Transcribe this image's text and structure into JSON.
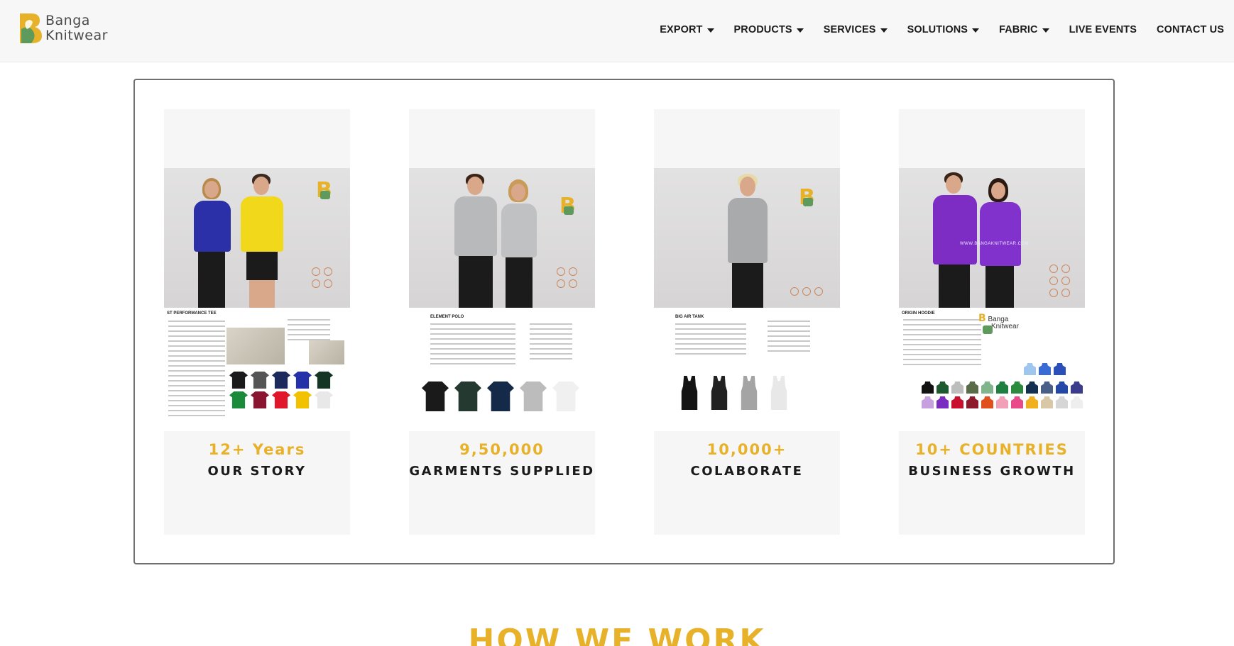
{
  "brand": {
    "line1": "Banga",
    "line2": "Knitwear"
  },
  "nav": [
    {
      "label": "EXPORT",
      "dropdown": true
    },
    {
      "label": "PRODUCTS",
      "dropdown": true
    },
    {
      "label": "SERVICES",
      "dropdown": true
    },
    {
      "label": "SOLUTIONS",
      "dropdown": true
    },
    {
      "label": "FABRIC",
      "dropdown": true
    },
    {
      "label": "LIVE EVENTS",
      "dropdown": false
    },
    {
      "label": "CONTACT US",
      "dropdown": false
    }
  ],
  "cards": [
    {
      "sheet_title": "ST PERFORMANCE TEE",
      "stat": "12+ Years",
      "caption": "OUR STORY"
    },
    {
      "sheet_title": "ELEMENT POLO",
      "stat": "9,50,000",
      "caption": "GARMENTS SUPPLIED"
    },
    {
      "sheet_title": "BIG AIR TANK",
      "stat": "10,000+",
      "caption": "COLABORATE"
    },
    {
      "sheet_title": "ORIGIN HOODIE",
      "stat": "10+ COUNTRIES",
      "caption": "BUSINESS GROWTH"
    }
  ],
  "watermark": "WWW.BANGAKNITWEAR.COM",
  "section_heading": "HOW WE WORK",
  "colors": {
    "accent": "#e7b22a",
    "brand_green": "#5d9a5b",
    "text_dark": "#1a1a1a"
  }
}
